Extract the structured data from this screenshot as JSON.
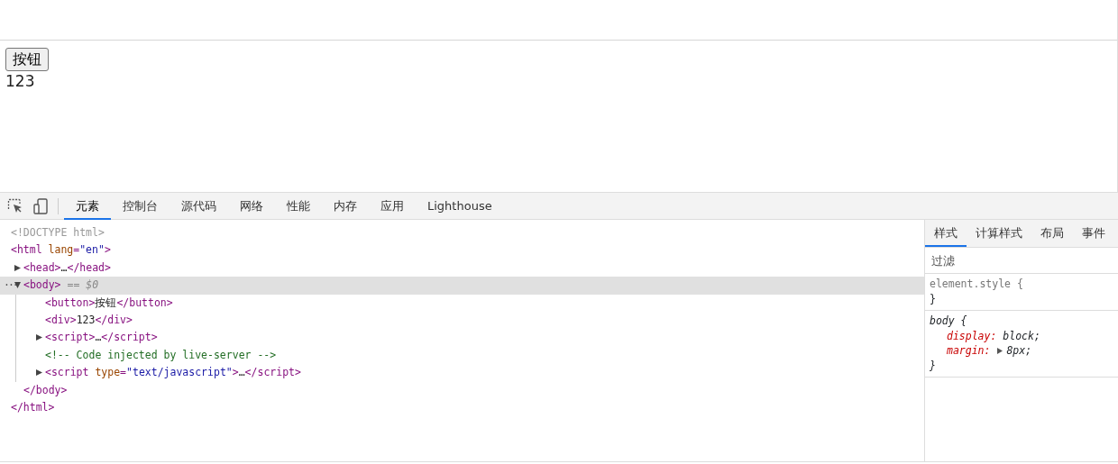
{
  "page": {
    "button": "按钮",
    "text": "123"
  },
  "devtools": {
    "tabs": [
      {
        "label": "元素",
        "selected": true
      },
      {
        "label": "控制台",
        "selected": false
      },
      {
        "label": "源代码",
        "selected": false
      },
      {
        "label": "网络",
        "selected": false
      },
      {
        "label": "性能",
        "selected": false
      },
      {
        "label": "内存",
        "selected": false
      },
      {
        "label": "应用",
        "selected": false
      },
      {
        "label": "Lighthouse",
        "selected": false
      }
    ],
    "dom_tree": [
      {
        "segments": [
          {
            "kind": "doctype",
            "text": "<!DOCTYPE html>"
          }
        ]
      },
      {
        "segments": [
          {
            "kind": "tag",
            "text": "<html "
          },
          {
            "kind": "attr_name",
            "text": "lang"
          },
          {
            "kind": "tag",
            "text": "="
          },
          {
            "kind": "attr_value",
            "text": "\"en\""
          },
          {
            "kind": "tag",
            "text": ">"
          }
        ],
        "closing": [
          {
            "kind": "tag",
            "text": "</html>"
          }
        ],
        "children": [
          {
            "expanded": false,
            "selected": false,
            "segments": [
              {
                "kind": "tag",
                "text": "<head>"
              },
              {
                "kind": "text",
                "text": "…"
              },
              {
                "kind": "tag",
                "text": "</head>"
              }
            ]
          },
          {
            "expanded": true,
            "selected": true,
            "more": "···",
            "segments": [
              {
                "kind": "tag",
                "text": "<body>"
              },
              {
                "kind": "hint",
                "text": " == $0"
              }
            ],
            "closing": [
              {
                "kind": "tag",
                "text": "</body>"
              }
            ],
            "children": [
              {
                "segments": [
                  {
                    "kind": "tag",
                    "text": "<button>"
                  },
                  {
                    "kind": "text",
                    "text": "按钮"
                  },
                  {
                    "kind": "tag",
                    "text": "</button>"
                  }
                ]
              },
              {
                "segments": [
                  {
                    "kind": "tag",
                    "text": "<div>"
                  },
                  {
                    "kind": "text",
                    "text": "123"
                  },
                  {
                    "kind": "tag",
                    "text": "</div>"
                  }
                ]
              },
              {
                "expanded": false,
                "selected": false,
                "segments": [
                  {
                    "kind": "tag",
                    "text": "<script>"
                  },
                  {
                    "kind": "text",
                    "text": "…"
                  },
                  {
                    "kind": "tag",
                    "text": "</script>"
                  }
                ]
              },
              {
                "segments": [
                  {
                    "kind": "comment",
                    "text": "<!-- Code injected by live-server -->"
                  }
                ]
              },
              {
                "expanded": false,
                "selected": false,
                "segments": [
                  {
                    "kind": "tag",
                    "text": "<script "
                  },
                  {
                    "kind": "attr_name",
                    "text": "type"
                  },
                  {
                    "kind": "tag",
                    "text": "="
                  },
                  {
                    "kind": "attr_value",
                    "text": "\"text/javascript\""
                  },
                  {
                    "kind": "tag",
                    "text": ">"
                  },
                  {
                    "kind": "text",
                    "text": "…"
                  },
                  {
                    "kind": "tag",
                    "text": "</script>"
                  }
                ]
              }
            ]
          }
        ]
      }
    ],
    "styles_pane": {
      "tabs": [
        {
          "label": "样式",
          "selected": true
        },
        {
          "label": "计算样式",
          "selected": false
        },
        {
          "label": "布局",
          "selected": false
        },
        {
          "label": "事件",
          "selected": false
        }
      ],
      "filter": {
        "placeholder": "过滤"
      },
      "rules": [
        {
          "kind": "inline",
          "selector": "element.style",
          "open": "{",
          "close": "}"
        },
        {
          "kind": "user_agent",
          "selector": "body",
          "open": "{",
          "close": "}",
          "declarations": [
            {
              "property": "display:",
              "value": "block;",
              "expandable": false
            },
            {
              "property": "margin:",
              "value": "8px;",
              "expandable": true
            }
          ]
        }
      ]
    }
  }
}
